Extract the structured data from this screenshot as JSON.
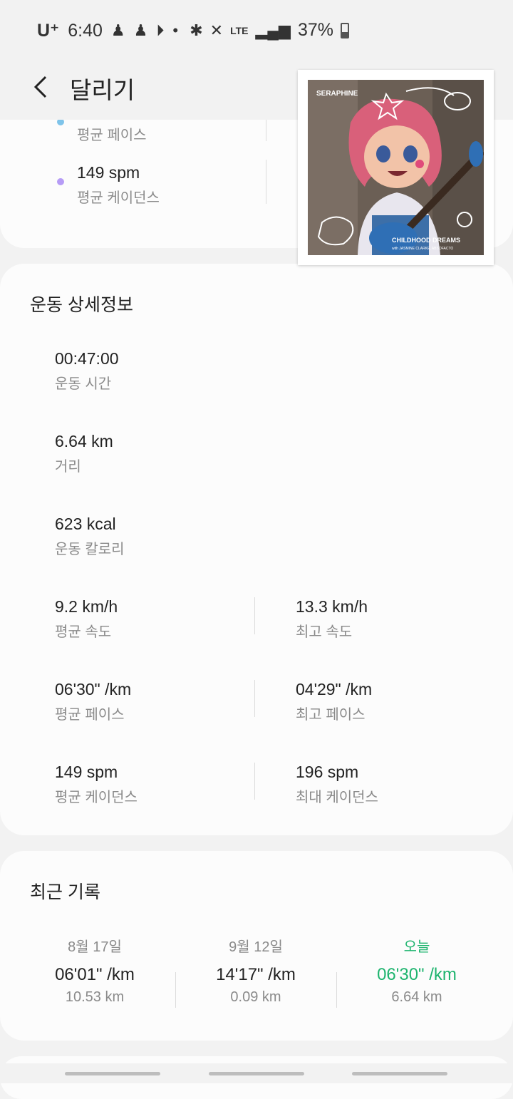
{
  "status": {
    "carrier": "U⁺",
    "time": "6:40",
    "network": "LTE",
    "battery": "37%",
    "battery_level": 0.37
  },
  "header": {
    "title": "달리기"
  },
  "summary": {
    "rows": [
      {
        "label": "평균 페이스",
        "dot_color": "#7fc4ea"
      },
      {
        "value": "149 spm",
        "label": "평균 케이던스",
        "dot_color": "#b69cf6"
      }
    ]
  },
  "details": {
    "title": "운동 상세정보",
    "single": [
      {
        "value": "00:47:00",
        "label": "운동 시간"
      },
      {
        "value": "6.64 km",
        "label": "거리"
      },
      {
        "value": "623 kcal",
        "label": "운동 칼로리"
      }
    ],
    "pairs": [
      {
        "left": {
          "value": "9.2 km/h",
          "label": "평균 속도"
        },
        "right": {
          "value": "13.3 km/h",
          "label": "최고 속도"
        }
      },
      {
        "left": {
          "value": "06'30\" /km",
          "label": "평균 페이스"
        },
        "right": {
          "value": "04'29\" /km",
          "label": "최고 페이스"
        }
      },
      {
        "left": {
          "value": "149 spm",
          "label": "평균 케이던스"
        },
        "right": {
          "value": "196 spm",
          "label": "최대 케이던스"
        }
      }
    ]
  },
  "recent": {
    "title": "최근 기록",
    "records": [
      {
        "date": "8월 17일",
        "pace": "06'01\" /km",
        "distance": "10.53 km"
      },
      {
        "date": "9월 12일",
        "pace": "14'17\" /km",
        "distance": "0.09 km"
      },
      {
        "date": "오늘",
        "pace": "06'30\" /km",
        "distance": "6.64 km"
      }
    ],
    "today_color": "#1db46e"
  },
  "media": {
    "artist": "SERAPHINE",
    "album": "CHILDHOOD DREAMS",
    "credits": "with JASMINE CLARKE, ABSOFACTO"
  }
}
